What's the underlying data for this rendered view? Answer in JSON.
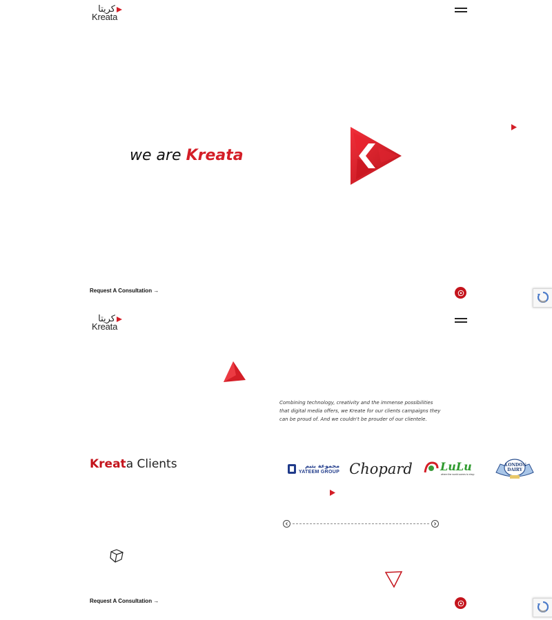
{
  "header": {
    "logo_ar": "كريتا",
    "logo_en": "Kreata",
    "menu_icon": "hamburger-icon"
  },
  "hero": {
    "title_prefix": "we are ",
    "title_brand": "Kreata"
  },
  "cta": {
    "label": "Request A Consultation",
    "arrow": "→"
  },
  "about": {
    "description": "Combining technology, creativity and the immense possibilities that digital media offers, we Kreate for our clients campaigns they can be proud of. And we couldn't be prouder of our clientele."
  },
  "clients": {
    "title_red": "Kreat",
    "title_rest": "a Clients",
    "logos": [
      {
        "ar": "مجموعة يتيم",
        "en": "YATEEM GROUP"
      },
      {
        "name": "Chopard"
      },
      {
        "name": "LuLu",
        "tagline": "where the world comes to shop"
      },
      {
        "name": "LONDON DAIRY"
      }
    ],
    "prev_icon": "chevron-left-icon",
    "next_icon": "chevron-right-icon"
  },
  "icons": {
    "whatsapp": "whatsapp-icon",
    "recaptcha": "recaptcha-icon"
  },
  "colors": {
    "brand_red": "#d41e27",
    "dark_red": "#c4141c",
    "text": "#111111",
    "background": "#ffffff"
  }
}
